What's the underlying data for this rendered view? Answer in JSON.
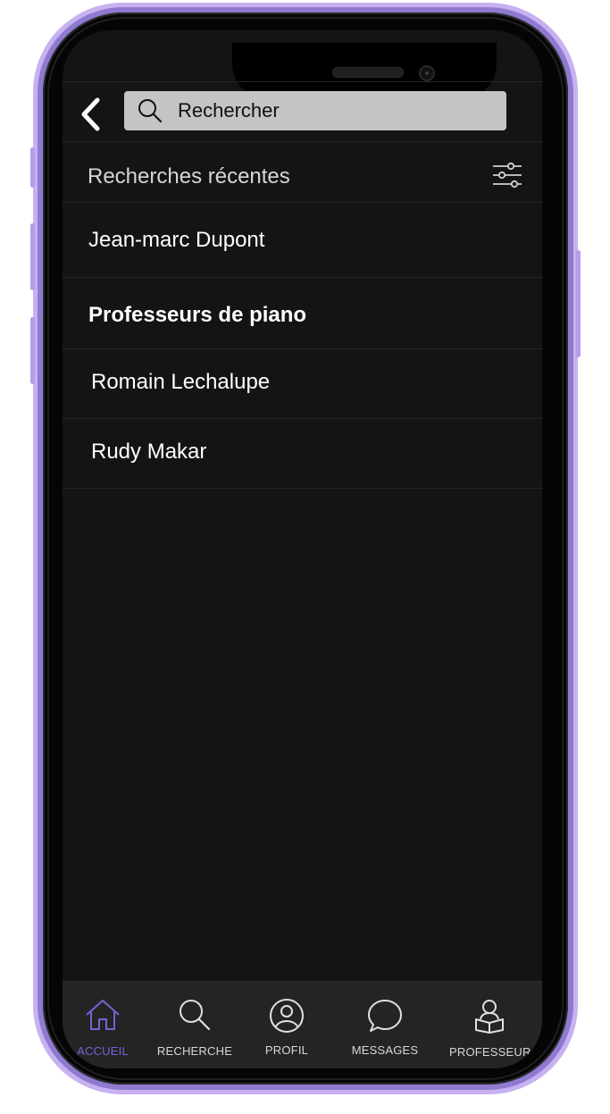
{
  "search": {
    "placeholder": "Rechercher"
  },
  "recent": {
    "title": "Recherches récentes",
    "items": [
      {
        "label": "Jean-marc Dupont"
      },
      {
        "label": "Professeurs de piano"
      },
      {
        "label": "Romain Lechalupe"
      },
      {
        "label": "Rudy Makar"
      }
    ]
  },
  "nav": {
    "items": [
      {
        "label": "ACCUEIL",
        "icon": "home-icon",
        "active": true
      },
      {
        "label": "RECHERCHE",
        "icon": "search-icon",
        "active": false
      },
      {
        "label": "PROFIL",
        "icon": "profile-icon",
        "active": false
      },
      {
        "label": "MESSAGES",
        "icon": "chat-bubble-icon",
        "active": false
      },
      {
        "label": "PROFESSEUR",
        "icon": "teacher-icon",
        "active": false
      }
    ]
  },
  "colors": {
    "accent": "#7b61d6",
    "background": "#141414",
    "frame": "#c7b1f0"
  }
}
